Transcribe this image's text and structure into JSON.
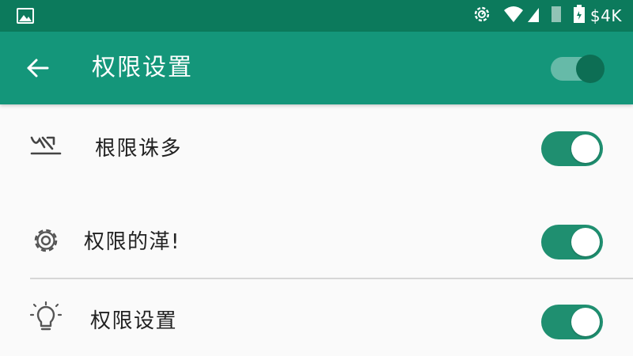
{
  "status_bar": {
    "right_text": "$4K",
    "icons": [
      "image-icon",
      "sync-gear-icon",
      "wifi-icon",
      "signal-icon",
      "sim-icon",
      "battery-icon"
    ]
  },
  "app_bar": {
    "title": "权限设置",
    "back_icon": "arrow-left-icon",
    "master_switch_on": true
  },
  "settings": [
    {
      "label": "根限诛多",
      "icon": "route-icon",
      "enabled": true
    },
    {
      "label": "权限的㴖!",
      "icon": "gear-icon",
      "enabled": true
    },
    {
      "label": "权限设置",
      "icon": "lightbulb-icon",
      "enabled": true
    }
  ],
  "colors": {
    "status_bar": "#0c7a5c",
    "app_bar": "#14967a",
    "toggle_track": "#1f8f70",
    "background": "#fafafa",
    "divider": "#d6d6d6"
  }
}
